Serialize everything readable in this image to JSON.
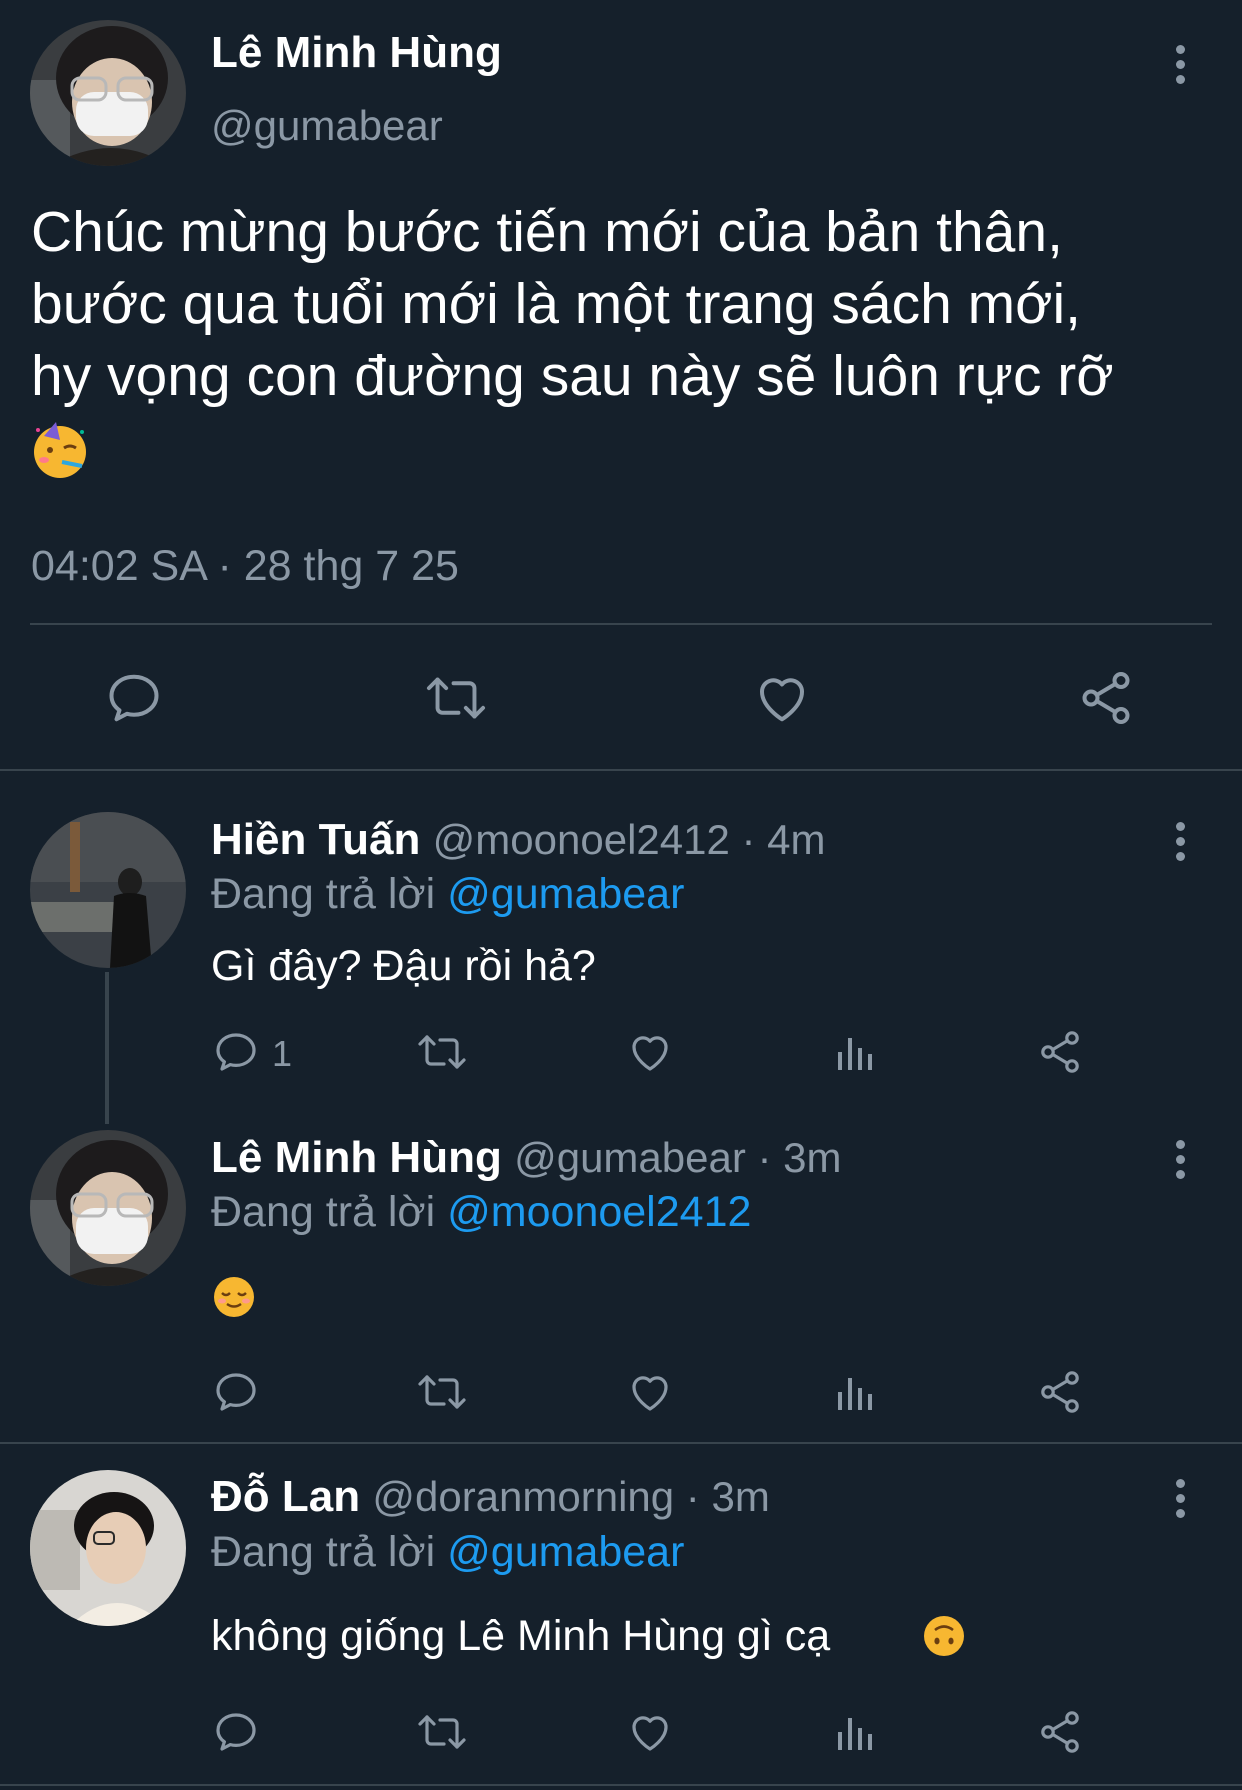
{
  "main_tweet": {
    "author_name": "Lê Minh Hùng",
    "handle": "@gumabear",
    "text_lines": [
      "Chúc mừng bước tiến mới của bản thân,",
      "bước qua tuổi mới là một trang sách mới,",
      "hy vọng con đường sau này sẽ luôn rực rỡ"
    ],
    "emoji": "partying-face",
    "timestamp": "04:02 SA · 28 thg 7 25"
  },
  "replies": [
    {
      "author_name": "Hiền Tuấn",
      "handle_time": "@moonoel2412 · 4m",
      "replying_prefix": "Đang trả lời",
      "replying_to": "@gumabear",
      "text": "Gì đây? Đậu rồi hả?",
      "reply_count": "1"
    },
    {
      "author_name": "Lê Minh Hùng",
      "handle_time": "@gumabear · 3m",
      "replying_prefix": "Đang trả lời",
      "replying_to": "@moonoel2412",
      "text": "",
      "emoji": "relieved-face"
    },
    {
      "author_name": "Đỗ Lan",
      "handle_time": "@doranmorning · 3m",
      "replying_prefix": "Đang trả lời",
      "replying_to": "@gumabear",
      "text": "không giống Lê Minh Hùng gì cạ",
      "emoji": "upside-down-face"
    }
  ],
  "colors": {
    "background": "#15202b",
    "text": "#ffffff",
    "muted": "#8b98a5",
    "link": "#1d9bf0",
    "divider": "#38444d"
  }
}
